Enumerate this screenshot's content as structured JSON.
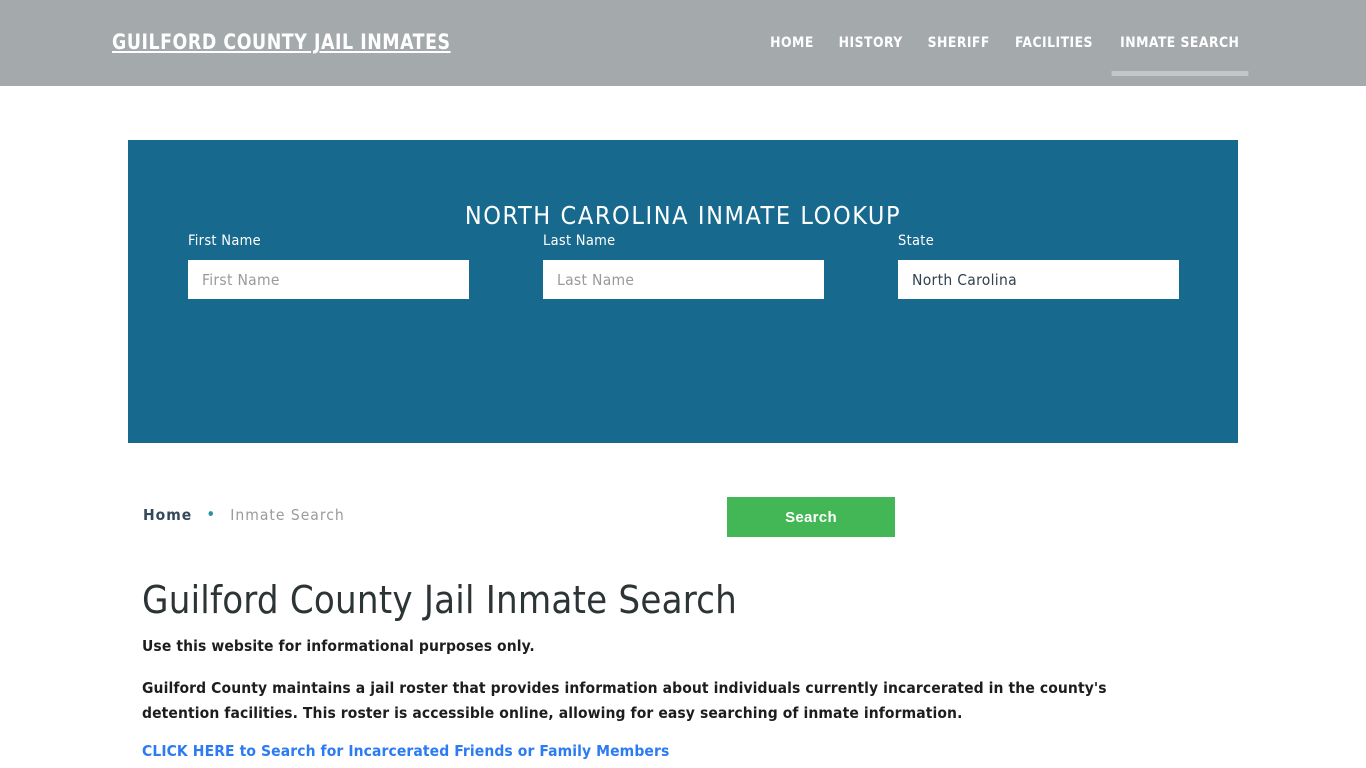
{
  "header": {
    "brand": "GUILFORD COUNTY JAIL INMATES",
    "nav": [
      {
        "label": "HOME",
        "active": false
      },
      {
        "label": "HISTORY",
        "active": false
      },
      {
        "label": "SHERIFF",
        "active": false
      },
      {
        "label": "FACILITIES",
        "active": false
      },
      {
        "label": "INMATE SEARCH",
        "active": true
      }
    ],
    "background_color": "#a4a9ac"
  },
  "lookup": {
    "title": "NORTH CAROLINA INMATE LOOKUP",
    "panel_color": "#176a8e",
    "fields": {
      "first_name": {
        "label": "First Name",
        "value": "",
        "placeholder": "First Name"
      },
      "last_name": {
        "label": "Last Name",
        "value": "",
        "placeholder": "Last Name"
      },
      "state": {
        "label": "State",
        "value": "North Carolina",
        "placeholder": "State"
      }
    },
    "search_button": {
      "label": "Search",
      "color": "#43b755"
    }
  },
  "breadcrumb": {
    "home": "Home",
    "separator": "•",
    "current": "Inmate Search"
  },
  "content": {
    "title": "Guilford County Jail Inmate Search",
    "lede": "Use this website for informational purposes only.",
    "paragraph": "Guilford County maintains a jail roster that provides information about individuals currently incarcerated in the county's detention facilities. This roster is accessible online, allowing for easy searching of inmate information.",
    "cta_link": "CLICK HERE to Search for Incarcerated Friends or Family Members",
    "cta_color": "#2b7bf3"
  }
}
